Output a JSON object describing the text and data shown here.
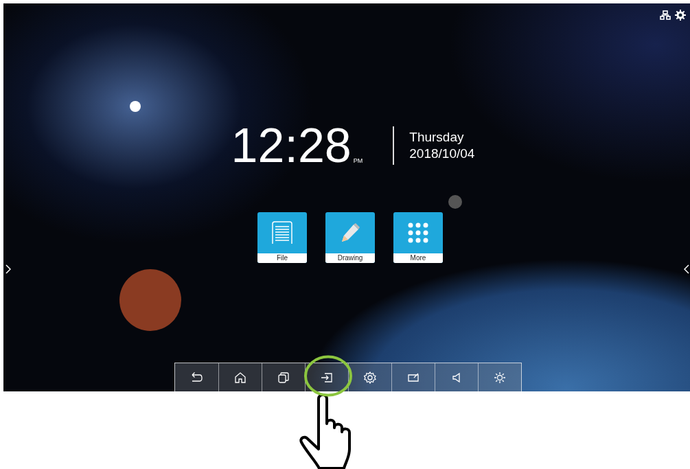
{
  "clock": {
    "time": "12:28",
    "meridiem": "PM",
    "weekday": "Thursday",
    "date": "2018/10/04"
  },
  "apps": [
    {
      "kind": "file",
      "label": "File"
    },
    {
      "kind": "drawing",
      "label": "Drawing"
    },
    {
      "kind": "more",
      "label": "More"
    }
  ],
  "dock": [
    {
      "kind": "back",
      "highlighted": false
    },
    {
      "kind": "home",
      "highlighted": false
    },
    {
      "kind": "windows",
      "highlighted": false
    },
    {
      "kind": "input",
      "highlighted": true
    },
    {
      "kind": "settings",
      "highlighted": false
    },
    {
      "kind": "annotate",
      "highlighted": false
    },
    {
      "kind": "volume",
      "highlighted": false
    },
    {
      "kind": "brightness",
      "highlighted": false
    }
  ]
}
